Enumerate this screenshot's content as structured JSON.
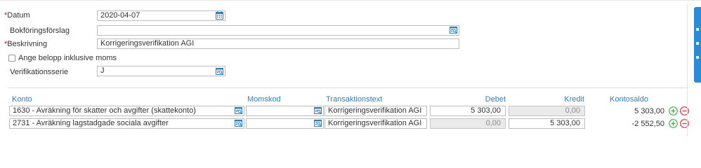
{
  "form": {
    "datum": {
      "label": "Datum",
      "value": "2020-04-07",
      "required": true
    },
    "bokforingsforslag": {
      "label": "Bokföringsförslag",
      "value": ""
    },
    "beskrivning": {
      "label": "Beskrivning",
      "value": "Korrigeringsverifikation AGI",
      "required": true
    },
    "inkl_moms": {
      "label": "Ange belopp inklusive moms",
      "checked": false
    },
    "verifikationsserie": {
      "label": "Verifikationsserie",
      "value": "J"
    },
    "required_marker": "*"
  },
  "table": {
    "headers": {
      "konto": "Konto",
      "momskod": "Momskod",
      "transaktionstext": "Transaktionstext",
      "debet": "Debet",
      "kredit": "Kredit",
      "kontosaldo": "Kontosaldo"
    },
    "rows": [
      {
        "konto": "1630 - Avräkning för skatter och avgifter (skattekonto)",
        "momskod": "",
        "transaktionstext": "Korrigeringsverifikation AGI",
        "debet": "5 303,00",
        "kredit": "0,00",
        "kontosaldo": "5 303,00"
      },
      {
        "konto": "2731 - Avräkning lagstadgade sociala avgifter",
        "momskod": "",
        "transaktionstext": "Korrigeringsverifikation AGI",
        "debet": "0,00",
        "kredit": "5 303,00",
        "kontosaldo": "-2 552,50"
      }
    ]
  },
  "colors": {
    "accent": "#2f7fc3",
    "required": "#d0021b",
    "add": "#4caf50",
    "remove": "#d9363e",
    "side_tab": "#2a8bd8"
  },
  "icons": {
    "lookup": "lookup-icon",
    "calendar": "calendar-icon",
    "add": "add-row-icon",
    "remove": "remove-row-icon"
  }
}
